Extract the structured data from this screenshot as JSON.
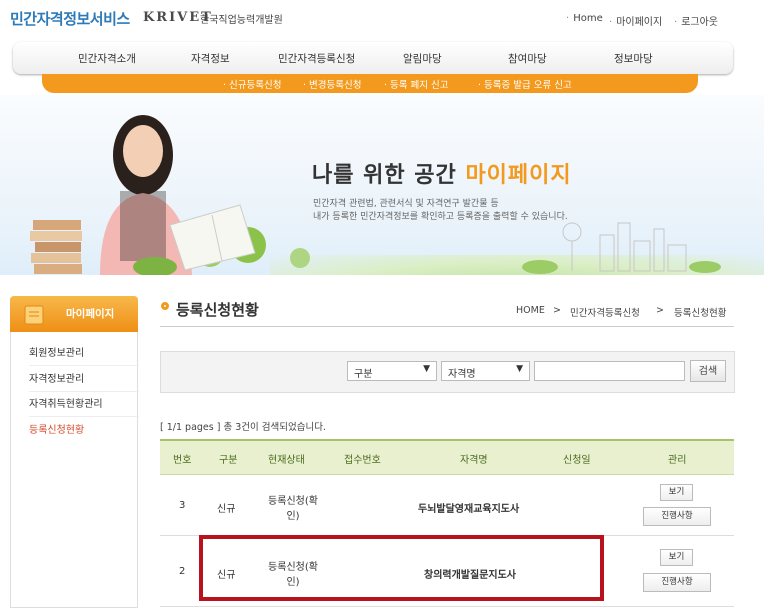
{
  "header": {
    "site_title": "민간자격정보서비스",
    "brand": "KRIVET",
    "brand_sub": "한국직업능력개발원",
    "util_links": [
      "Home",
      "마이페이지",
      "로그아웃"
    ]
  },
  "nav": {
    "items": [
      "민간자격소개",
      "자격정보",
      "민간자격등록신청",
      "알림마당",
      "참여마당",
      "정보마당"
    ],
    "sub_items": [
      "신규등록신청",
      "변경등록신청",
      "등록 폐지 신고",
      "등록증 발급 오류 신고"
    ]
  },
  "banner": {
    "title_main": "나를 위한 공간",
    "title_highlight": "마이페이지",
    "desc1": "민간자격 관련법, 관련서식 및 자격연구 발간물 등",
    "desc2": "내가 등록한 민간자격정보를 확인하고 등록증을 출력할 수 있습니다."
  },
  "sidebar": {
    "heading": "마이페이지",
    "items": [
      "회원정보관리",
      "자격정보관리",
      "자격취득현황관리",
      "등록신청현황"
    ]
  },
  "content": {
    "title": "등록신청현황",
    "breadcrumb": [
      "HOME",
      "민간자격등록신청",
      "등록신청현황"
    ],
    "breadcrumb_sep": ">"
  },
  "search": {
    "select1": "구분",
    "select2": "자격명",
    "input_value": "",
    "button": "검색"
  },
  "result_info": "[ 1/1 pages ] 총 3건이 검색되었습니다.",
  "table": {
    "headers": [
      "번호",
      "구분",
      "현재상태",
      "접수번호",
      "자격명",
      "신청일",
      "관리"
    ],
    "rows": [
      {
        "no": "3",
        "type": "신규",
        "status_line1": "등록신청(확",
        "status_line2": "인)",
        "receipt": "",
        "name": "두뇌발달영재교육지도사",
        "date": "",
        "btn_view": "보기",
        "btn_progress": "진행사항"
      },
      {
        "no": "2",
        "type": "신규",
        "status_line1": "등록신청(확",
        "status_line2": "인)",
        "receipt": "",
        "name": "창의력개발질문지도사",
        "date": "",
        "btn_view": "보기",
        "btn_progress": "진행사항"
      }
    ]
  },
  "colors": {
    "accent_orange": "#f39a1e",
    "header_blue": "#2e7ab8",
    "table_head_bg": "#e8f0cf",
    "highlight_red": "#b8121c"
  }
}
